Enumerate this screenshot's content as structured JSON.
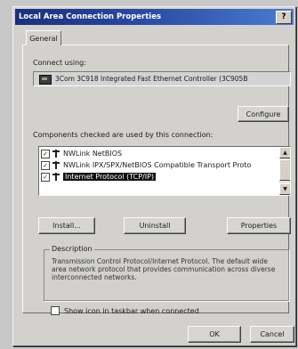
{
  "window": {
    "title": "Local Area Connection Properties",
    "help_label": "?"
  },
  "tabs": [
    {
      "label": "General",
      "active": true
    }
  ],
  "connect_using": {
    "label": "Connect using:",
    "adapter_name": "3Com 3C918 Integrated Fast Ethernet Controller (3C905B",
    "configure_label": "Configure"
  },
  "components": {
    "label": "Components checked are used by this connection:",
    "items": [
      {
        "label": "NWLink NetBIOS",
        "checked": true,
        "selected": false
      },
      {
        "label": "NWLink IPX/SPX/NetBIOS Compatible Transport Proto",
        "checked": true,
        "selected": false
      },
      {
        "label": "Internet Protocol (TCP/IP)",
        "checked": true,
        "selected": true
      }
    ]
  },
  "buttons": {
    "install": "Install...",
    "uninstall": "Uninstall",
    "properties": "Properties",
    "ok": "OK",
    "cancel": "Cancel"
  },
  "description": {
    "legend": "Description",
    "text": "Transmission Control Protocol/Internet Protocol. The default wide area network protocol that provides communication across diverse interconnected networks."
  },
  "show_icon": {
    "label": "Show icon in taskbar when connected",
    "checked": false
  }
}
